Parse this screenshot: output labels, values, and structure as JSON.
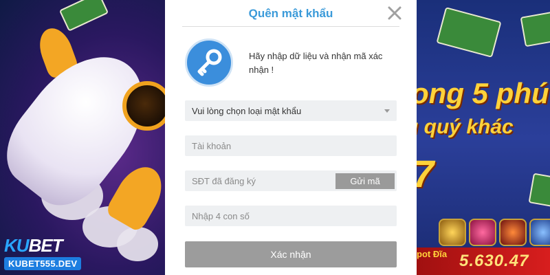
{
  "modal": {
    "title": "Quên mật khẩu",
    "intro_text": "Hãy nhập dữ liệu và nhận mã xác nhận !",
    "password_type_select": {
      "selected": "Vui lòng chọn loại mật khẩu"
    },
    "account_field": {
      "value": "",
      "placeholder": "Tài khoản"
    },
    "phone_field": {
      "value": "",
      "placeholder": "SĐT đã đăng ký"
    },
    "send_code_label": "Gửi mã",
    "code_field": {
      "value": "",
      "placeholder": "Nhập 4 con số"
    },
    "confirm_label": "Xác nhận"
  },
  "background": {
    "promo_line_1": "ong 5 phú",
    "promo_line_2": "ụ quý khác",
    "promo_line_3": "7",
    "jackpot_label": "pot Đĩa",
    "jackpot_value": "5.630.47"
  },
  "logo": {
    "brand_prefix": "KU",
    "brand_suffix": "BET",
    "domain": "KUBET555.DEV"
  },
  "icons": [
    "key-icon",
    "close-icon",
    "chevron-down-icon"
  ],
  "colors": {
    "title": "#3a9ad9",
    "key_circle": "#3b8edc",
    "button_gray": "#9a9a9a",
    "field_bg": "#eef0f2"
  }
}
